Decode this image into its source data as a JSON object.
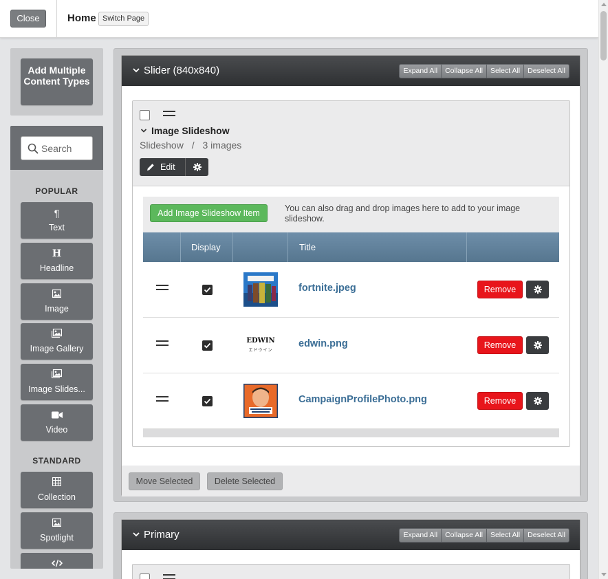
{
  "topbar": {
    "close_label": "Close",
    "page_title": "Home",
    "switch_label": "Switch Page"
  },
  "sidebar": {
    "add_multiple_label": "Add Multiple Content Types",
    "search_placeholder": "Search",
    "popular_heading": "POPULAR",
    "standard_heading": "STANDARD",
    "popular_items": [
      {
        "label": "Text",
        "icon": "paragraph-icon"
      },
      {
        "label": "Headline",
        "icon": "heading-icon"
      },
      {
        "label": "Image",
        "icon": "image-icon"
      },
      {
        "label": "Image Gallery",
        "icon": "images-icon"
      },
      {
        "label": "Image Slides...",
        "icon": "images-icon"
      },
      {
        "label": "Video",
        "icon": "video-camera-icon"
      }
    ],
    "standard_items": [
      {
        "label": "Collection",
        "icon": "grid-icon"
      },
      {
        "label": "Spotlight",
        "icon": "image-icon"
      },
      {
        "label": "",
        "icon": "code-icon"
      }
    ]
  },
  "header_buttons": {
    "expand_all": "Expand All",
    "collapse_all": "Collapse All",
    "select_all": "Select All",
    "deselect_all": "Deselect All"
  },
  "slider_panel": {
    "title": "Slider (840x840)",
    "item": {
      "title": "Image Slideshow",
      "type": "Slideshow",
      "separator": "/",
      "count": "3 images",
      "edit_label": "Edit"
    },
    "gallery": {
      "add_label": "Add Image Slideshow Item",
      "hint": "You can also drag and drop images here to add to your image slideshow.",
      "columns": [
        "",
        "Display",
        "",
        "Title",
        ""
      ],
      "rows": [
        {
          "filename": "fortnite.jpeg",
          "display": true,
          "remove_label": "Remove",
          "thumb": "fortnite"
        },
        {
          "filename": "edwin.png",
          "display": true,
          "remove_label": "Remove",
          "thumb": "edwin",
          "thumb_text": "EDWIN",
          "thumb_subtext": "エドウイン"
        },
        {
          "filename": "CampaignProfilePhoto.png",
          "display": true,
          "remove_label": "Remove",
          "thumb": "campaign"
        }
      ]
    },
    "move_selected_label": "Move Selected",
    "delete_selected_label": "Delete Selected"
  },
  "primary_panel": {
    "title": "Primary"
  },
  "colors": {
    "accent_green": "#5cb85c",
    "remove_red": "#e8151b",
    "link_blue": "#3b6e96",
    "header_dark": "#2e3032",
    "table_header": "#56768f"
  }
}
